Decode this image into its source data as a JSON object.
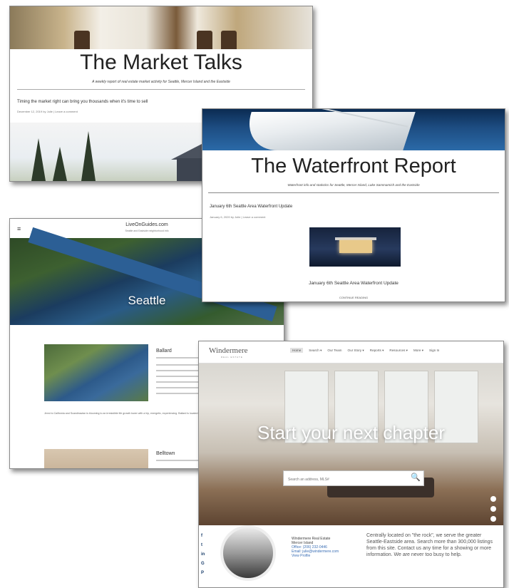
{
  "market_talks": {
    "title": "The Market Talks",
    "subtitle": "A weekly report of real estate market activity for Seattle, Mercer Island and the Eastside",
    "post_title": "Timing the market right can bring you thousands when it's time to sell",
    "post_meta": "December 12, 2019 by Julie  |  Leave a comment"
  },
  "waterfront": {
    "title": "The Waterfront Report",
    "subtitle": "Waterfront info and statistics for Seattle, Mercer Island, Lake Sammamish and the Eastside",
    "post_title": "January 6th Seattle Area Waterfront Update",
    "post_meta": "January 6, 2020 by Julie  |  Leave a comment",
    "caption": "January 6th Seattle Area Waterfront Update",
    "more": "CONTINUE READING"
  },
  "liveon": {
    "menu_glyph": "≡",
    "site_name": "LiveOnGuides.com",
    "tagline": "Seattle and Eastside neighborhood info",
    "city": "Seattle",
    "neighborhood1": "Ballard",
    "paragraph": "Jenni to California and Scandinavian is blooming to an irresistible life growth tower with a hip, energetic, experiencing. Ballard is located in the northwestern part of Seattle.",
    "neighborhood2": "Belltown"
  },
  "windermere": {
    "logo": "Windermere",
    "logo_sub": "REAL ESTATE",
    "nav": [
      "Home",
      "Search ▾",
      "Our Team",
      "Our Story ▾",
      "Reports ▾",
      "Resources ▾",
      "More ▾",
      "Sign In"
    ],
    "hero_tagline": "Start your next chapter",
    "search_placeholder": "Search an address, MLS#",
    "search_glyph": "🔍",
    "social": [
      "f",
      "t",
      "in",
      "G",
      "P"
    ],
    "agent_name": "Windermere Real Estate",
    "agent_office": "Mercer Island",
    "agent_phone": "Office: (206) 232-0446",
    "agent_email": "Email: julie@windermere.com",
    "agent_more": "View Profile",
    "blurb": "Centrally located on \"the rock\", we serve the greater Seattle-Eastside area. Search more than 300,000 listings from this site. Contact us any time for a showing or more information. We are never too busy to help."
  }
}
